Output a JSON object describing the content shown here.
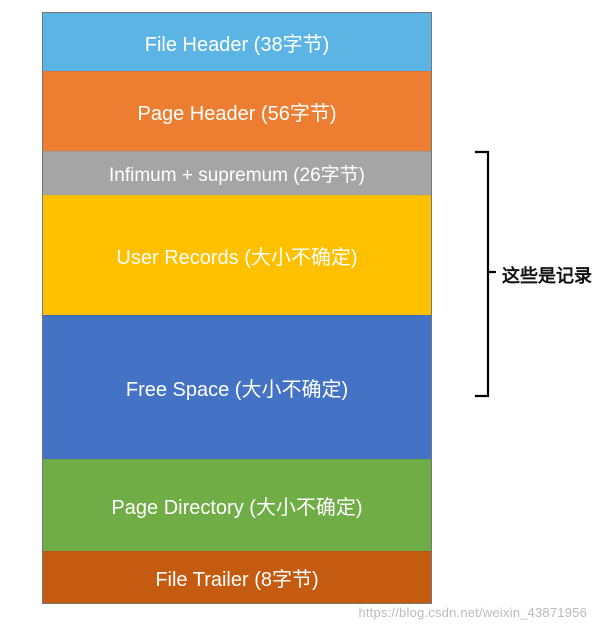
{
  "segments": {
    "file_header": {
      "label": "File Header (38字节)"
    },
    "page_header": {
      "label": "Page Header (56字节)"
    },
    "infi_sup": {
      "label": "Infimum + supremum (26字节)"
    },
    "user_records": {
      "label": "User Records (大小不确定)"
    },
    "free_space": {
      "label": "Free Space (大小不确定)"
    },
    "page_directory": {
      "label": "Page Directory (大小不确定)"
    },
    "file_trailer": {
      "label": "File Trailer (8字节)"
    }
  },
  "annotation": {
    "records_label": "这些是记录"
  },
  "watermark": "https://blog.csdn.net/weixin_43871956",
  "colors": {
    "file_header": "#5cb4e4",
    "page_header": "#ed7d31",
    "infi_sup": "#a5a5a5",
    "user_records": "#ffc000",
    "free_space": "#4472c4",
    "page_directory": "#70ad47",
    "file_trailer": "#c55a11"
  }
}
